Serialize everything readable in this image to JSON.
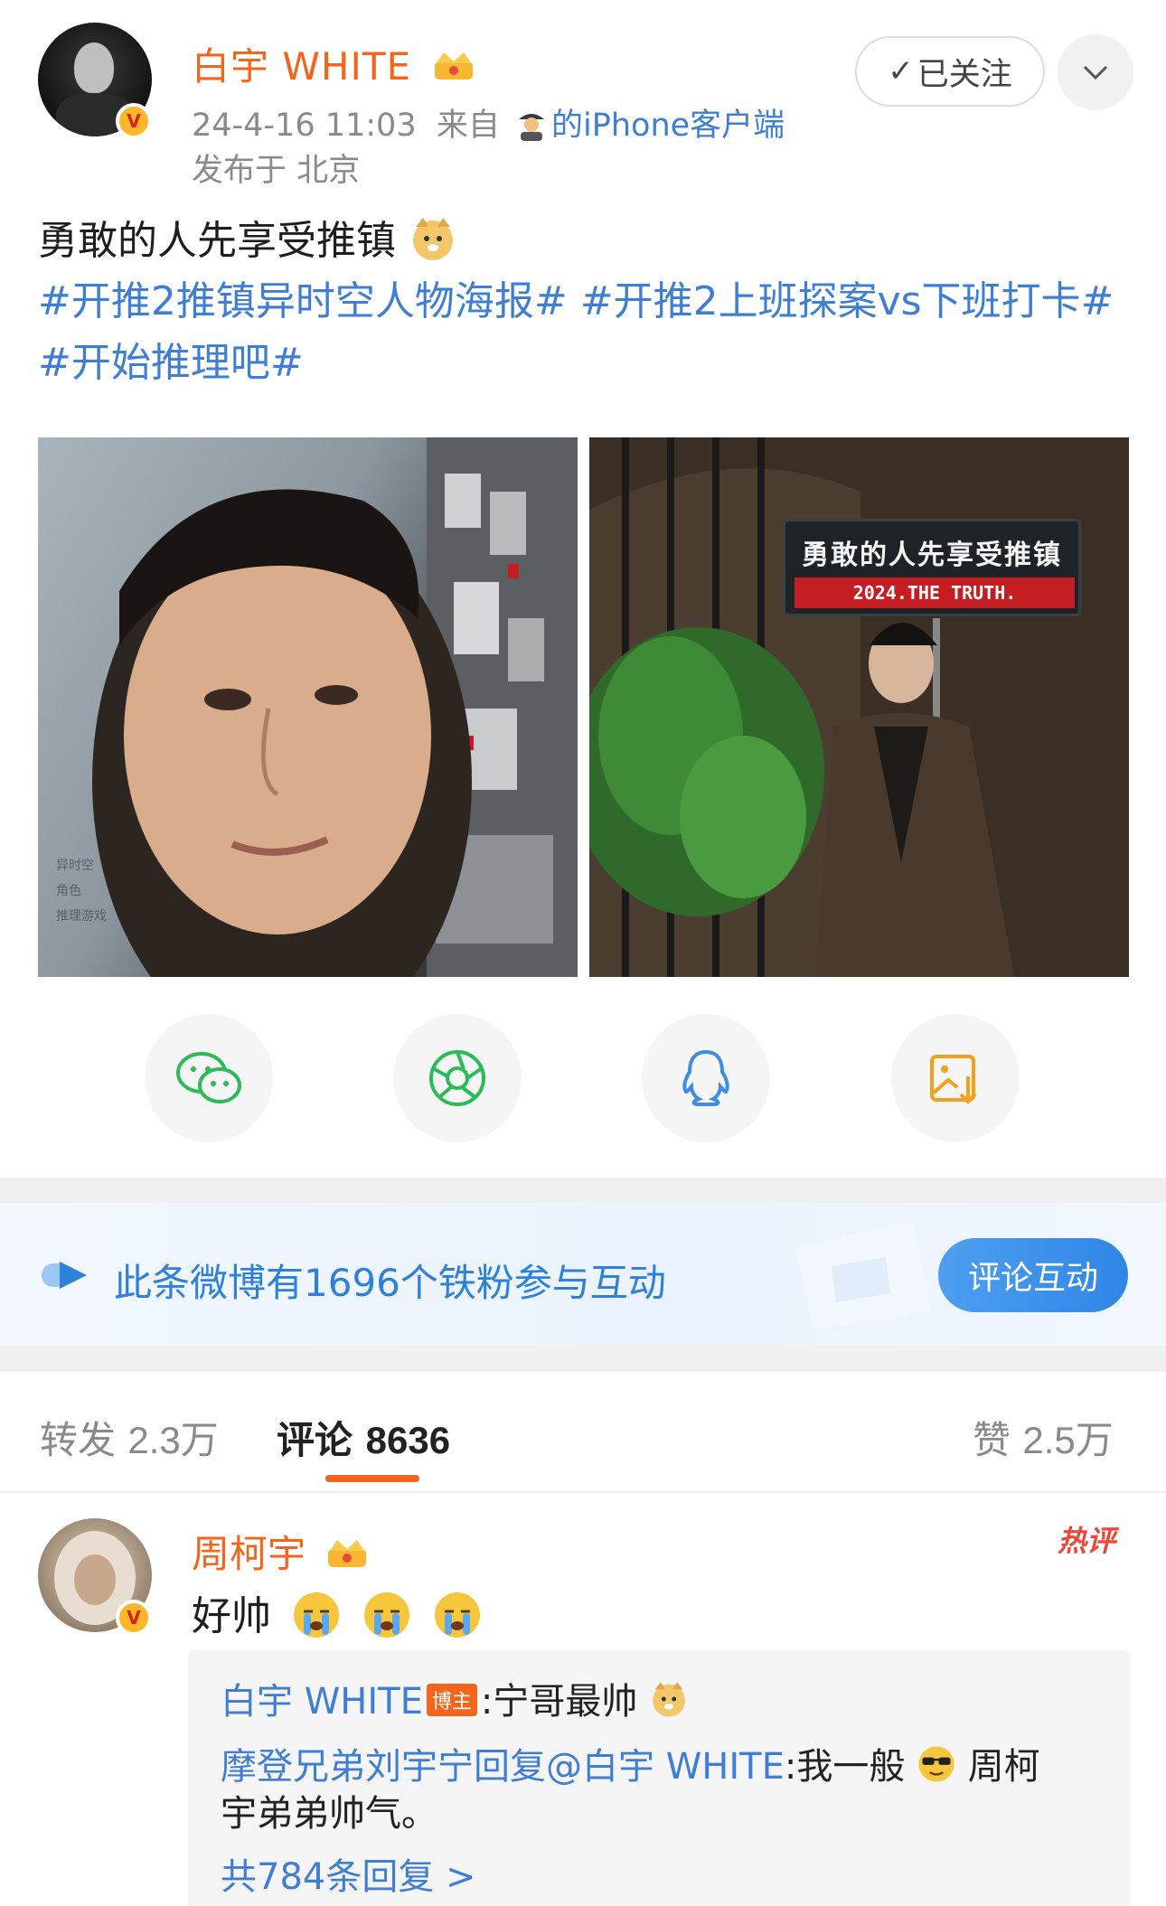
{
  "post": {
    "author_name": "白宇 WHITE",
    "date": "24-4-16 11:03",
    "from_prefix": "来自",
    "source_name": "的iPhone客户端",
    "location": "发布于 北京",
    "follow_label": "已关注",
    "text": "勇敢的人先享受推镇",
    "tags": "#开推2推镇异时空人物海报# #开推2上班探案vs下班打卡# #开始推理吧#",
    "images": [
      {
        "name": "poster-left",
        "caption_lines": [
          "异时空",
          "角色",
          "推理游戏"
        ]
      },
      {
        "name": "poster-right",
        "sign_title": "勇敢的人先享受推镇",
        "sign_sub": "2024.THE TRUTH."
      }
    ]
  },
  "share": {
    "items": [
      "wechat-icon",
      "moments-icon",
      "qq-icon",
      "save-image-icon"
    ],
    "colors": {
      "wechat": "#2dbb58",
      "moments": "#2dbb58",
      "qq": "#3f8de0",
      "save": "#f0a21a"
    }
  },
  "fans_banner": {
    "text": "此条微博有1696个铁粉参与互动",
    "button_label": "评论互动"
  },
  "tabs": {
    "repost_label": "转发",
    "repost_count": "2.3万",
    "comment_label": "评论",
    "comment_count": "8636",
    "like_label": "赞",
    "like_count": "2.5万"
  },
  "comment": {
    "user_name": "周柯宇",
    "hot_label": "热评",
    "text": "好帅",
    "reply_author": "白宇 WHITE",
    "blogger_badge": "博主",
    "reply_text": ":宁哥最帅",
    "reply2_user": "摩登兄弟刘宇宁回复",
    "reply2_mention": "@白宇 WHITE",
    "reply2_text": ":我一般",
    "reply2_suffix": "周柯",
    "reply2_cont": "宇弟弟帅气。",
    "more_replies": "共784条回复 >"
  },
  "colors": {
    "brand_orange": "#f2651b",
    "link_blue": "#3f7ed0"
  }
}
